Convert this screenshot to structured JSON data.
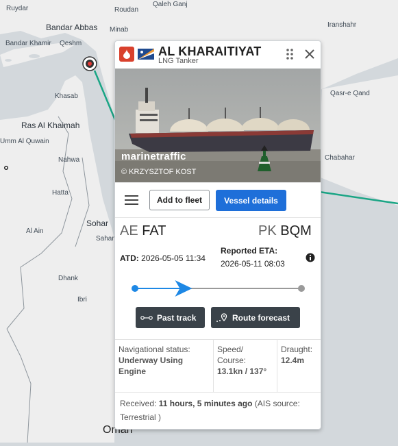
{
  "map": {
    "labels": {
      "ruydar": "Ruydar",
      "roudan": "Roudan",
      "qaleh_ganj": "Qaleh Ganj",
      "bandar_abbas": "Bandar Abbas",
      "minab": "Minab",
      "iranshahr": "Iranshahr",
      "bandar_khamir": "Bandar Khamir",
      "qeshm": "Qeshm",
      "khasab": "Khasab",
      "qasr_e_qand": "Qasr-e Qand",
      "ras_al_khaimah": "Ras Al Khaimah",
      "umm_al_quwain": "Umm Al Quwain",
      "nahwa": "Nahwa",
      "chabahar": "Chabahar",
      "hatta": "Hatta",
      "sohar": "Sohar",
      "al_ain": "Al Ain",
      "saham": "Saham",
      "dhank": "Dhank",
      "ibri": "Ibri",
      "oman": "Oman"
    }
  },
  "vessel": {
    "name": "AL KHARAITIYAT",
    "type": "LNG Tanker",
    "photo_watermark": "marinetraffic",
    "photo_credit": "© KRZYSZTOF KOST",
    "flag_colors": {
      "badge": "#d9412d",
      "flag_blue": "#1f4a8f",
      "flag_orange": "#f39c33"
    }
  },
  "actions": {
    "add_to_fleet": "Add to fleet",
    "vessel_details": "Vessel details"
  },
  "voyage": {
    "origin_country": "AE",
    "origin_port": "FAT",
    "dest_country": "PK",
    "dest_port": "BQM",
    "atd_label": "ATD:",
    "atd_value": "2026-05-05 11:34",
    "eta_label": "Reported ETA:",
    "eta_value": "2026-05-11 08:03",
    "progress_fraction": 0.29
  },
  "buttons": {
    "past_track": "Past track",
    "route_forecast": "Route forecast"
  },
  "status": {
    "nav_label": "Navigational status:",
    "nav_value": "Underway Using Engine",
    "speed_label": "Speed/ Course:",
    "speed_value": "13.1kn / 137°",
    "draught_label": "Draught:",
    "draught_value": "12.4m"
  },
  "received": {
    "label": "Received:",
    "age": "11 hours, 5 minutes ago",
    "source": "(AIS source: Terrestrial )"
  },
  "colors": {
    "accent": "#1e6fd9",
    "progress": "#1e88e5",
    "route": "#1aa585",
    "dark_button": "#3a4249"
  }
}
